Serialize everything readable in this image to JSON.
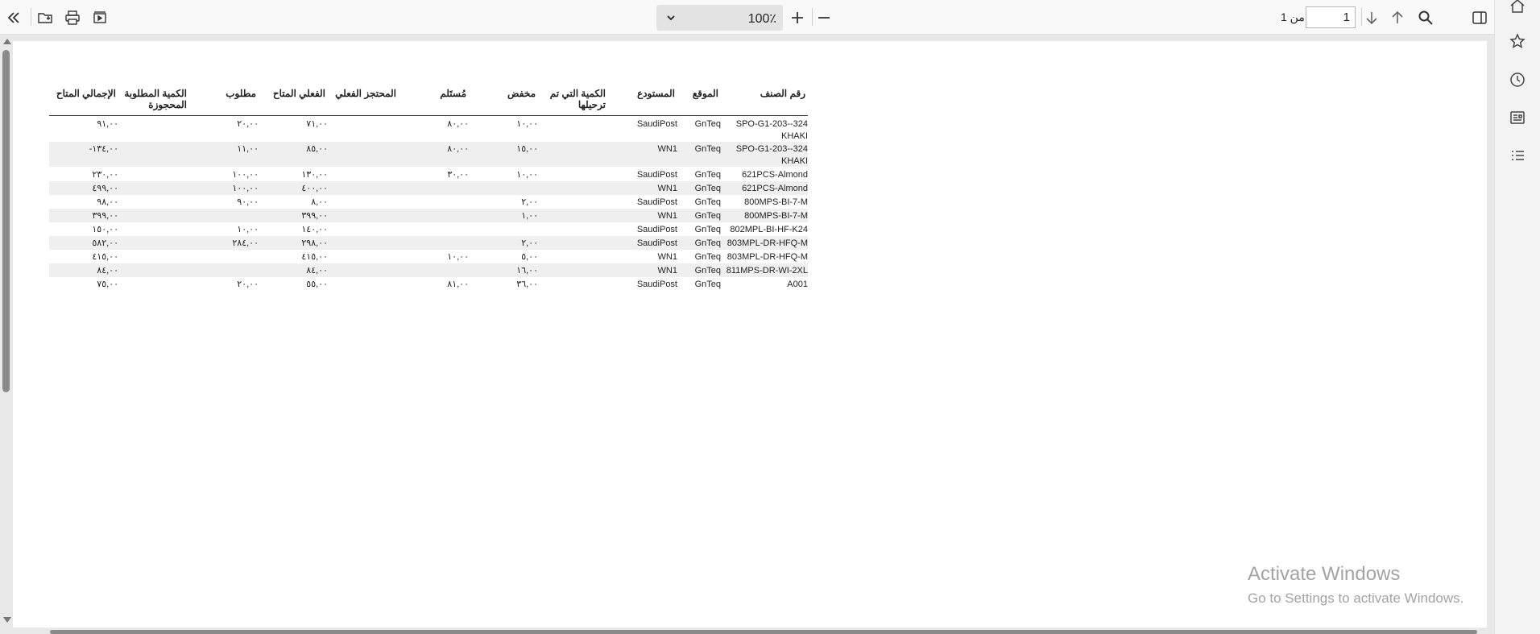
{
  "toolbar": {
    "zoom_value": "100٪",
    "page_number": "1",
    "page_of": "من 1"
  },
  "report": {
    "headers": {
      "item_no": "رقم الصنف",
      "location": "الموقع",
      "warehouse": "المستودع",
      "qty_posted": "الكمية التي تم ترحيلها",
      "reduced": "مخفض",
      "received": "مُستَلم",
      "reserved_actual": "المحتجز الفعلي",
      "available_actual": "الفعلي المتاح",
      "required": "مطلوب",
      "qty_required_reserved": "الكمية المطلوبة المحجوزة",
      "total_available": "الإجمالي المتاح"
    },
    "rows": [
      {
        "item_no": "SPO-G1-203--324",
        "item_no2": "KHAKI",
        "location": "GnTeq",
        "warehouse": "SaudiPost",
        "reduced": "١٠,٠٠",
        "received": "٨٠,٠٠",
        "available_actual": "٧١,٠٠",
        "required": "٢٠,٠٠",
        "total_available": "٩١,٠٠"
      },
      {
        "item_no": "SPO-G1-203--324",
        "item_no2": "KHAKI",
        "location": "GnTeq",
        "warehouse": "WN1",
        "reduced": "١٥,٠٠",
        "received": "٨٠,٠٠",
        "available_actual": "٨٥,٠٠",
        "required": "١١,٠٠",
        "total_available": "-١٣٤,٠٠"
      },
      {
        "item_no": "621PCS-Almond",
        "item_no2": "",
        "location": "GnTeq",
        "warehouse": "SaudiPost",
        "reduced": "١٠,٠٠",
        "received": "٣٠,٠٠",
        "available_actual": "١٣٠,٠٠",
        "required": "١٠٠,٠٠",
        "total_available": "٢٣٠,٠٠"
      },
      {
        "item_no": "621PCS-Almond",
        "item_no2": "",
        "location": "GnTeq",
        "warehouse": "WN1",
        "reduced": "",
        "received": "",
        "available_actual": "٤٠٠,٠٠",
        "required": "١٠٠,٠٠",
        "total_available": "٤٩٩,٠٠"
      },
      {
        "item_no": "800MPS-BI-7-M",
        "item_no2": "",
        "location": "GnTeq",
        "warehouse": "SaudiPost",
        "reduced": "٢,٠٠",
        "received": "",
        "available_actual": "٨,٠٠",
        "required": "٩٠,٠٠",
        "total_available": "٩٨,٠٠"
      },
      {
        "item_no": "800MPS-BI-7-M",
        "item_no2": "",
        "location": "GnTeq",
        "warehouse": "WN1",
        "reduced": "١,٠٠",
        "received": "",
        "available_actual": "٣٩٩,٠٠",
        "required": "",
        "total_available": "٣٩٩,٠٠"
      },
      {
        "item_no": "802MPL-BI-HF-K24",
        "item_no2": "",
        "location": "GnTeq",
        "warehouse": "SaudiPost",
        "reduced": "",
        "received": "",
        "available_actual": "١٤٠,٠٠",
        "required": "١٠,٠٠",
        "total_available": "١٥٠,٠٠"
      },
      {
        "item_no": "803MPL-DR-HFQ-M",
        "item_no2": "",
        "location": "GnTeq",
        "warehouse": "SaudiPost",
        "reduced": "٢,٠٠",
        "received": "",
        "available_actual": "٢٩٨,٠٠",
        "required": "٢٨٤,٠٠",
        "total_available": "٥٨٢,٠٠"
      },
      {
        "item_no": "803MPL-DR-HFQ-M",
        "item_no2": "",
        "location": "GnTeq",
        "warehouse": "WN1",
        "reduced": "٥,٠٠",
        "received": "١٠,٠٠",
        "available_actual": "٤١٥,٠٠",
        "required": "",
        "total_available": "٤١٥,٠٠"
      },
      {
        "item_no": "811MPS-DR-WI-2XL",
        "item_no2": "",
        "location": "GnTeq",
        "warehouse": "WN1",
        "reduced": "١٦,٠٠",
        "received": "",
        "available_actual": "٨٤,٠٠",
        "required": "",
        "total_available": "٨٤,٠٠"
      },
      {
        "item_no": "A001",
        "item_no2": "",
        "location": "GnTeq",
        "warehouse": "SaudiPost",
        "reduced": "٣٦,٠٠",
        "received": "٨١,٠٠",
        "available_actual": "٥٥,٠٠",
        "required": "٢٠,٠٠",
        "total_available": "٧٥,٠٠"
      }
    ]
  },
  "watermark": {
    "line1": "Activate Windows",
    "line2": "Go to Settings to activate Windows."
  }
}
